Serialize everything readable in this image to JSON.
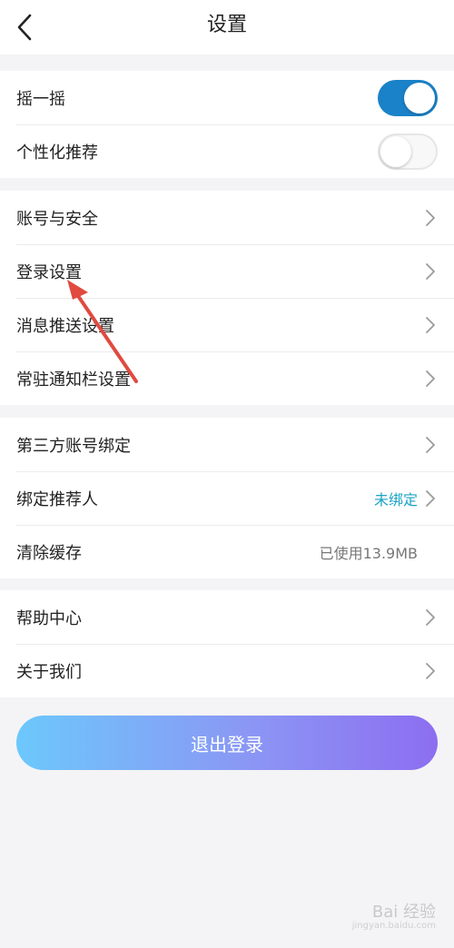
{
  "header": {
    "title": "设置",
    "back_icon": "chevron-left-icon"
  },
  "groups": {
    "toggles": [
      {
        "label": "摇一摇",
        "state": "on"
      },
      {
        "label": "个性化推荐",
        "state": "off"
      }
    ],
    "account": [
      {
        "label": "账号与安全"
      },
      {
        "label": "登录设置"
      },
      {
        "label": "消息推送设置"
      },
      {
        "label": "常驻通知栏设置"
      }
    ],
    "misc": [
      {
        "label": "第三方账号绑定"
      },
      {
        "label": "绑定推荐人",
        "value": "未绑定"
      },
      {
        "label": "清除缓存",
        "value": "已使用13.9MB"
      }
    ],
    "help": [
      {
        "label": "帮助中心"
      },
      {
        "label": "关于我们"
      }
    ]
  },
  "logout_label": "退出登录",
  "watermark": {
    "text": "Bai 经验",
    "sub": "jingyan.baidu.com"
  },
  "colors": {
    "toggle_on": "#1a82c8",
    "value_highlight": "#1aa3c7",
    "button_gradient_start": "#6cc8fc",
    "button_gradient_end": "#8c6ef1",
    "annotation_arrow": "#e04a3f"
  }
}
